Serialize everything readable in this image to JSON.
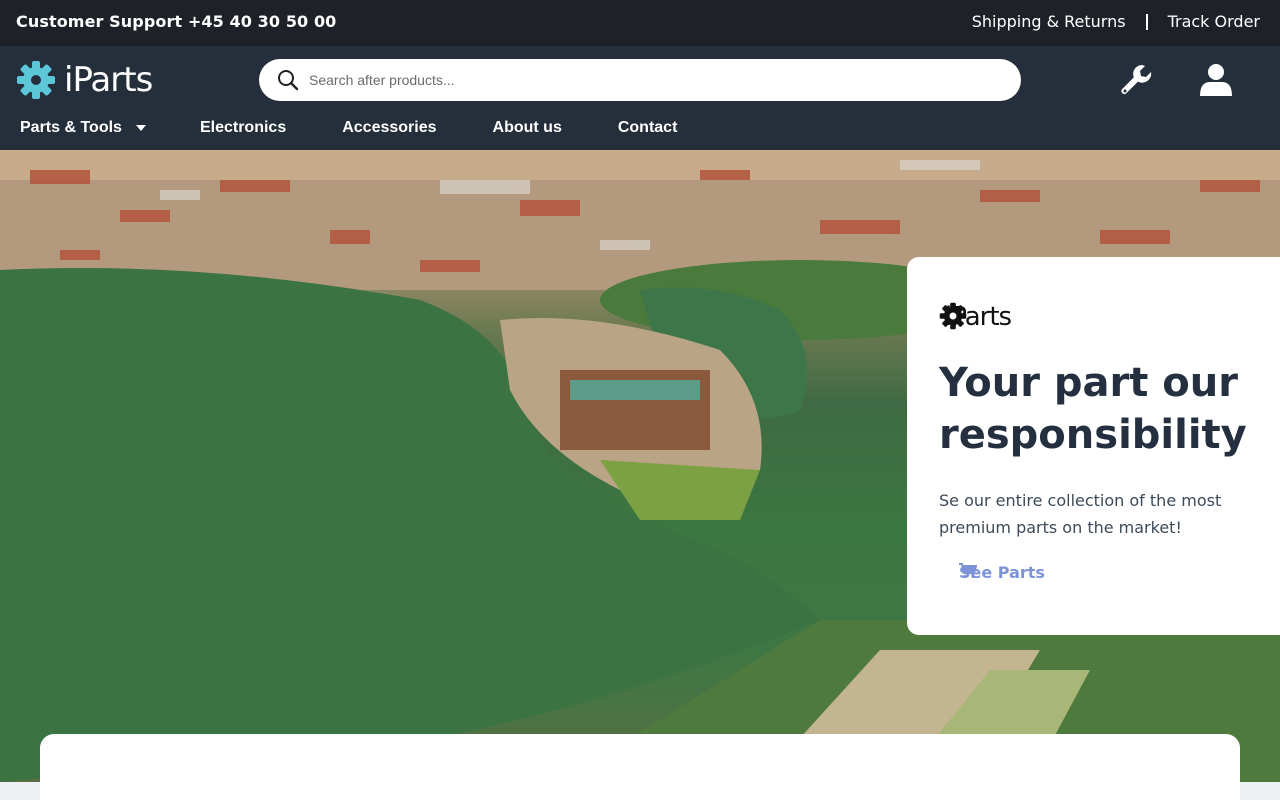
{
  "topbar": {
    "support": "Customer Support +45 40 30 50 00",
    "shipping": "Shipping & Returns",
    "track": "Track Order"
  },
  "header": {
    "logo_text": "iParts",
    "search_placeholder": "Search after products...",
    "icons": [
      "wrench-icon",
      "user-icon"
    ],
    "accent_color": "#5cc7d9"
  },
  "nav": {
    "items": [
      {
        "label": "Parts & Tools"
      },
      {
        "label": "Electronics"
      },
      {
        "label": "Accessories"
      },
      {
        "label": "About us"
      },
      {
        "label": "Contact"
      }
    ]
  },
  "hero": {
    "logo_text": "iParts",
    "headline": "Your part our responsibility",
    "description": "Se our entire collection of the most premium parts on the market!",
    "cta": "See Parts",
    "cta_color": "#7c93d8"
  }
}
